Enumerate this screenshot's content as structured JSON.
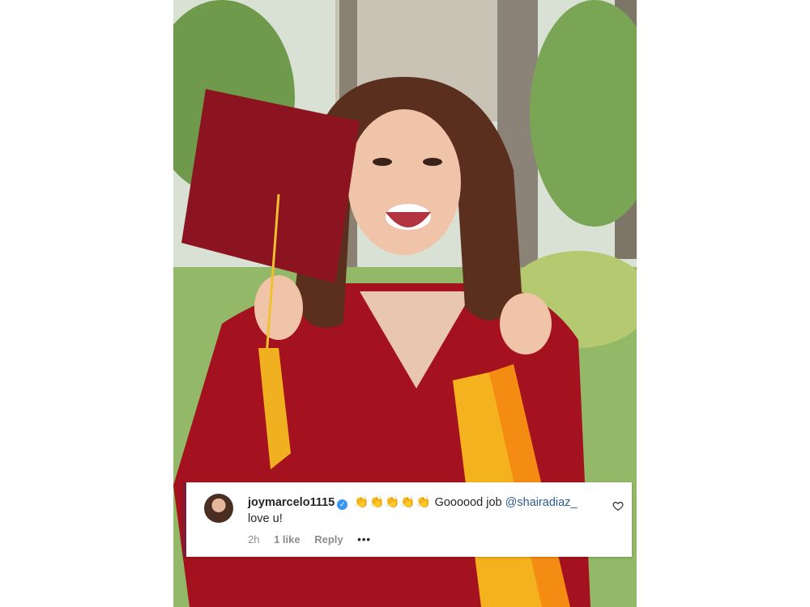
{
  "photo": {
    "icon": "graduation-photo"
  },
  "comment": {
    "username": "joymarcelo1115",
    "verified": true,
    "emojis": "👏👏👏👏👏",
    "text_before_mention": "Goooood job",
    "mention": "@shairadiaz_",
    "text_after": "love u!",
    "time": "2h",
    "likes": "1 like",
    "reply_label": "Reply",
    "more": "•••"
  },
  "colors": {
    "accent_border": "#7a1c3a",
    "verified_blue": "#3897f0",
    "mention_blue": "#2b5d8f",
    "meta_gray": "#8e8e8e"
  }
}
